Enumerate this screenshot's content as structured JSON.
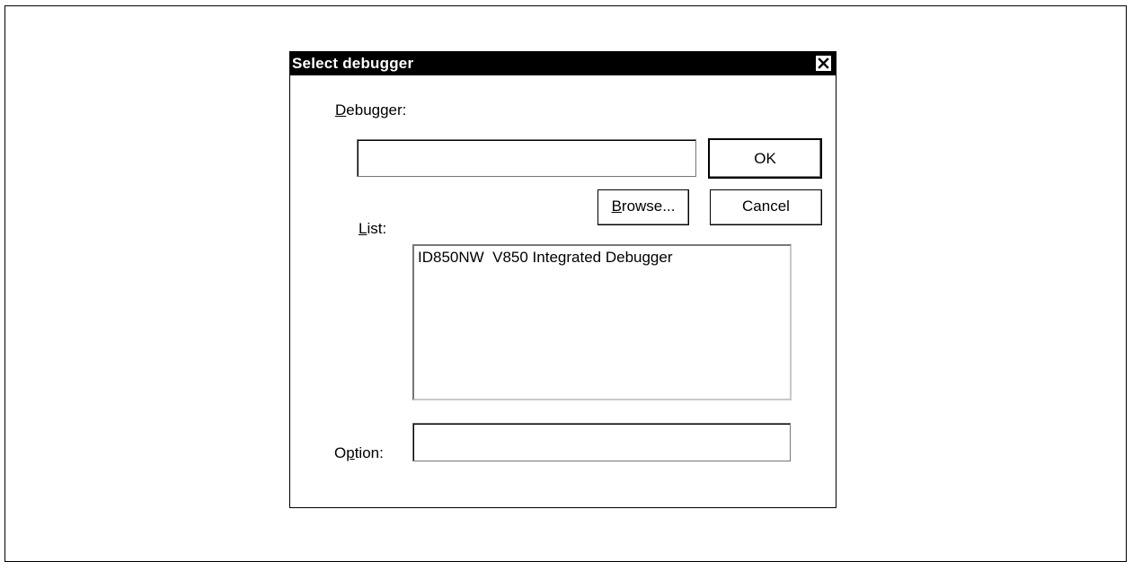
{
  "dialog": {
    "title": "Select debugger",
    "close_icon": "close-icon"
  },
  "debugger": {
    "label_accel": "D",
    "label_rest": "ebugger:",
    "value": ""
  },
  "buttons": {
    "ok": "OK",
    "cancel": "Cancel",
    "browse_accel": "B",
    "browse_rest": "rowse..."
  },
  "list": {
    "label_accel": "L",
    "label_rest": "ist:",
    "items": [
      "ID850NW  V850 Integrated Debugger"
    ]
  },
  "option": {
    "label_pre": "O",
    "label_accel": "p",
    "label_rest": "tion:",
    "value": ""
  }
}
